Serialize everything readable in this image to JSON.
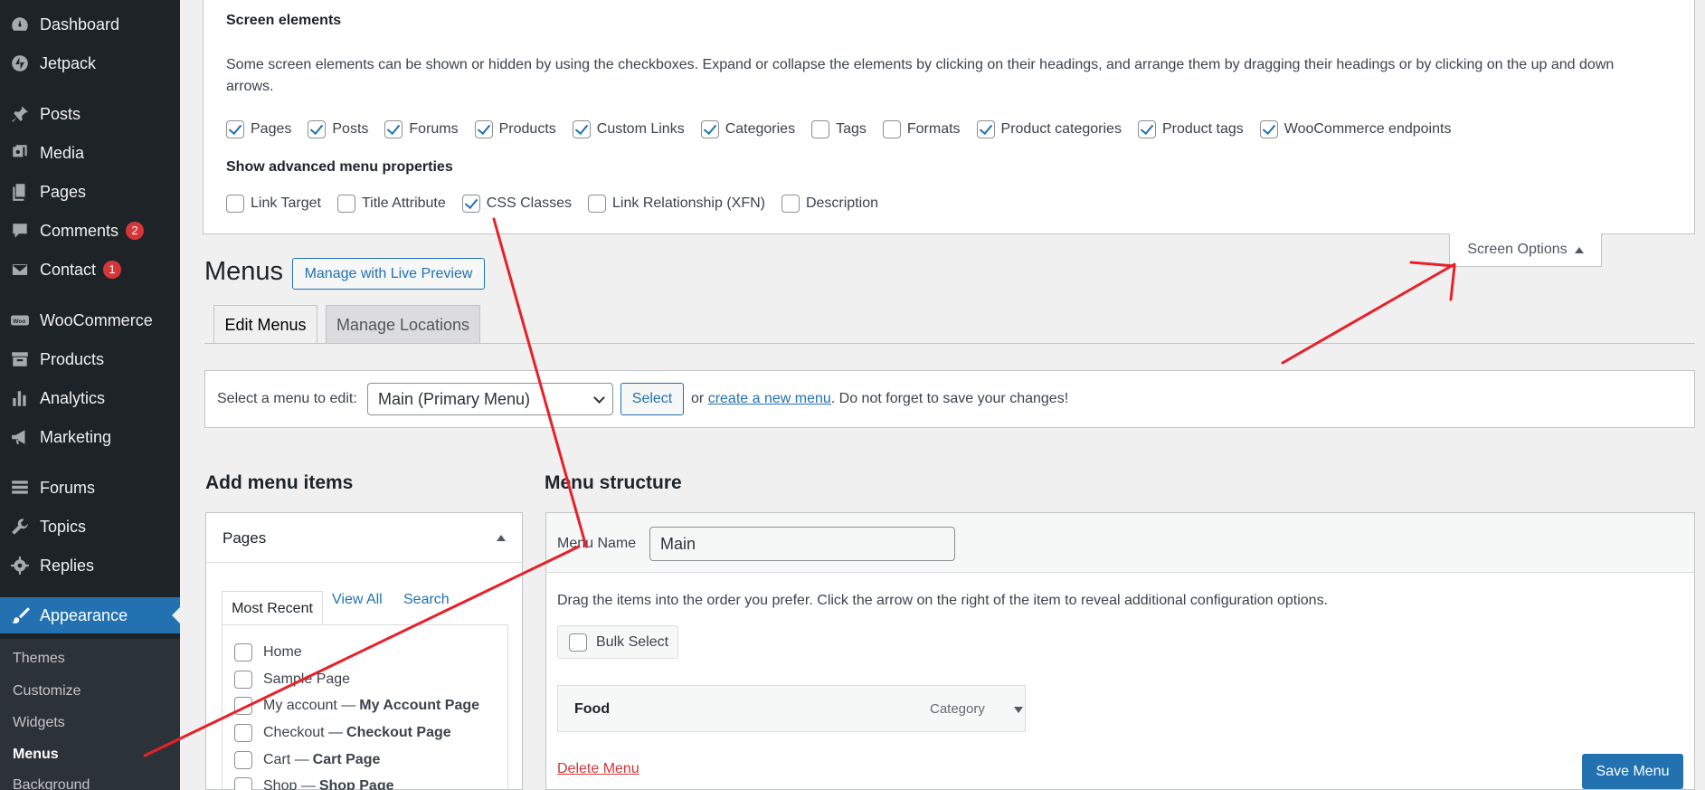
{
  "sidebar": {
    "items": [
      {
        "label": "Dashboard",
        "icon": "dashboard-icon"
      },
      {
        "label": "Jetpack",
        "icon": "jetpack-icon"
      },
      {
        "label": "Posts",
        "icon": "pin-icon"
      },
      {
        "label": "Media",
        "icon": "media-icon"
      },
      {
        "label": "Pages",
        "icon": "pages-icon"
      },
      {
        "label": "Comments",
        "icon": "comment-icon",
        "badge": "2"
      },
      {
        "label": "Contact",
        "icon": "mail-icon",
        "badge": "1"
      },
      {
        "label": "WooCommerce",
        "icon": "woo-icon"
      },
      {
        "label": "Products",
        "icon": "archive-icon"
      },
      {
        "label": "Analytics",
        "icon": "chart-icon"
      },
      {
        "label": "Marketing",
        "icon": "megaphone-icon"
      },
      {
        "label": "Forums",
        "icon": "forums-icon"
      },
      {
        "label": "Topics",
        "icon": "tools-icon"
      },
      {
        "label": "Replies",
        "icon": "gear-icon"
      },
      {
        "label": "Appearance",
        "icon": "brush-icon"
      }
    ],
    "submenu": [
      "Themes",
      "Customize",
      "Widgets",
      "Menus",
      "Background"
    ]
  },
  "screen_options": {
    "heading": "Screen elements",
    "description": "Some screen elements can be shown or hidden by using the checkboxes. Expand or collapse the elements by clicking on their headings, and arrange them by dragging their headings or by clicking on the up and down arrows.",
    "boxes": [
      {
        "label": "Pages",
        "checked": true
      },
      {
        "label": "Posts",
        "checked": true
      },
      {
        "label": "Forums",
        "checked": true
      },
      {
        "label": "Products",
        "checked": true
      },
      {
        "label": "Custom Links",
        "checked": true
      },
      {
        "label": "Categories",
        "checked": true
      },
      {
        "label": "Tags",
        "checked": false
      },
      {
        "label": "Formats",
        "checked": false
      },
      {
        "label": "Product categories",
        "checked": true
      },
      {
        "label": "Product tags",
        "checked": true
      },
      {
        "label": "WooCommerce endpoints",
        "checked": true
      }
    ],
    "advanced_heading": "Show advanced menu properties",
    "advanced": [
      {
        "label": "Link Target",
        "checked": false
      },
      {
        "label": "Title Attribute",
        "checked": false
      },
      {
        "label": "CSS Classes",
        "checked": true
      },
      {
        "label": "Link Relationship (XFN)",
        "checked": false
      },
      {
        "label": "Description",
        "checked": false
      }
    ],
    "tab_label": "Screen Options"
  },
  "header": {
    "title": "Menus",
    "live_preview": "Manage with Live Preview",
    "tabs": [
      "Edit Menus",
      "Manage Locations"
    ]
  },
  "select_menu": {
    "label": "Select a menu to edit:",
    "selected": "Main (Primary Menu)",
    "button": "Select",
    "help_prefix": "or",
    "link": "create a new menu",
    "help_suffix": ". Do not forget to save your changes!"
  },
  "add_items": {
    "heading": "Add menu items",
    "box_title": "Pages",
    "tabs": [
      "Most Recent",
      "View All",
      "Search"
    ],
    "pages": [
      {
        "name": "Home",
        "suffix": ""
      },
      {
        "name": "Sample Page",
        "suffix": ""
      },
      {
        "name": "My account —",
        "suffix": "My Account Page"
      },
      {
        "name": "Checkout —",
        "suffix": "Checkout Page"
      },
      {
        "name": "Cart —",
        "suffix": "Cart Page"
      },
      {
        "name": "Shop —",
        "suffix": "Shop Page"
      }
    ]
  },
  "structure": {
    "heading": "Menu structure",
    "name_label": "Menu Name",
    "name_value": "Main",
    "help": "Drag the items into the order you prefer. Click the arrow on the right of the item to reveal additional configuration options.",
    "bulk_select": "Bulk Select",
    "items": [
      {
        "title": "Food",
        "type": "Category"
      }
    ],
    "delete": "Delete Menu",
    "save": "Save Menu"
  },
  "colors": {
    "sidebar_bg": "#1d2327",
    "accent": "#2271b1",
    "badge": "#d63638",
    "annotation": "#e8202a"
  }
}
